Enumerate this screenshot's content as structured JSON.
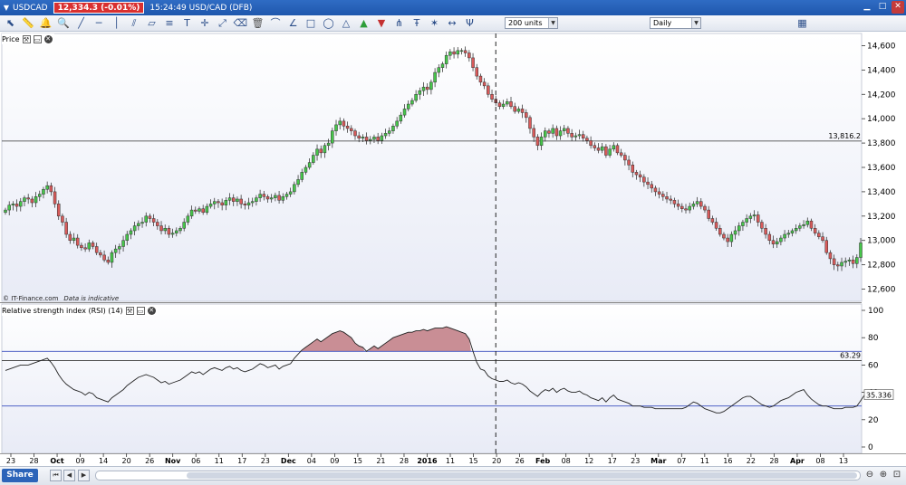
{
  "titlebar": {
    "symbol": "USDCAD",
    "price_badge": "12,334.3 (-0.01%)",
    "status": "15:24:49 USD/CAD (DFB)"
  },
  "toolbar": {
    "units_value": "200 units",
    "period_value": "Daily",
    "icons": [
      "cursor-icon",
      "ruler-icon",
      "bell-icon",
      "zoom-icon",
      "trend-line-icon",
      "horizontal-line-icon",
      "vertical-line-icon",
      "parallel-icon",
      "channel-icon",
      "fibonacci-icon",
      "text-icon",
      "crosshair-icon",
      "measure-icon",
      "eraser-icon",
      "trash-icon",
      "arc-icon",
      "angle-icon",
      "rectangle-icon",
      "ellipse-icon",
      "triangle-icon",
      "buy-arrow-icon",
      "sell-arrow-icon",
      "andrews-icon",
      "tk-icon",
      "gann-icon",
      "extend-icon",
      "pitchfork-icon",
      "chart-type-icon"
    ]
  },
  "price_panel": {
    "title": "Price",
    "credit": "© IT-Finance.com",
    "credit_note": "Data is indicative"
  },
  "rsi_panel": {
    "title": "Relative strength index (RSI) (14)",
    "current_label": "35.336"
  },
  "bottom": {
    "share_label": "Share"
  },
  "colors": {
    "up_candle": "#46c64a",
    "down_candle": "#d95a5a",
    "rsi_fill": "#c98e95",
    "band_line": "#3a4fbf",
    "plot_bg_top": "#ffffff",
    "plot_bg_bottom": "#e8ebf6"
  },
  "chart_data": [
    {
      "type": "candlestick",
      "title": "Price",
      "ylim": [
        12500,
        14700
      ],
      "y_ticks": [
        12600,
        12800,
        13000,
        13200,
        13400,
        13600,
        13800,
        14000,
        14200,
        14400,
        14600
      ],
      "y_tick_labels": [
        "12,600",
        "12,800",
        "13,000",
        "13,200",
        "13,400",
        "13,600",
        "13,800",
        "14,000",
        "14,200",
        "14,400",
        "14,600"
      ],
      "x_labels": [
        "23",
        "28",
        "Oct",
        "09",
        "14",
        "20",
        "26",
        "Nov",
        "06",
        "11",
        "17",
        "23",
        "Dec",
        "04",
        "09",
        "15",
        "21",
        "28",
        "2016",
        "11",
        "15",
        "20",
        "26",
        "Feb",
        "08",
        "12",
        "17",
        "23",
        "Mar",
        "07",
        "11",
        "16",
        "22",
        "28",
        "Apr",
        "08",
        "13"
      ],
      "bold_x_labels": [
        "Oct",
        "Nov",
        "Dec",
        "2016",
        "Feb",
        "Mar",
        "Apr"
      ],
      "horizontal_line": {
        "value": 13816.2,
        "label": "13,816.2"
      },
      "event_line_index": 129,
      "close": [
        13250,
        13290,
        13300,
        13280,
        13320,
        13350,
        13340,
        13310,
        13360,
        13380,
        13420,
        13450,
        13400,
        13300,
        13200,
        13150,
        13050,
        13000,
        13020,
        12960,
        12940,
        12930,
        12980,
        12950,
        12900,
        12880,
        12840,
        12820,
        12900,
        12930,
        12950,
        13000,
        13050,
        13080,
        13120,
        13140,
        13150,
        13200,
        13180,
        13150,
        13120,
        13080,
        13100,
        13050,
        13060,
        13080,
        13100,
        13150,
        13200,
        13250,
        13240,
        13260,
        13230,
        13280,
        13300,
        13320,
        13310,
        13290,
        13330,
        13350,
        13320,
        13340,
        13300,
        13290,
        13310,
        13320,
        13350,
        13380,
        13360,
        13340,
        13350,
        13370,
        13330,
        13360,
        13380,
        13400,
        13460,
        13500,
        13560,
        13600,
        13640,
        13700,
        13750,
        13720,
        13780,
        13800,
        13900,
        13950,
        13980,
        13940,
        13920,
        13900,
        13860,
        13840,
        13850,
        13820,
        13830,
        13850,
        13820,
        13860,
        13880,
        13900,
        13940,
        13980,
        14030,
        14080,
        14120,
        14150,
        14200,
        14230,
        14260,
        14240,
        14300,
        14380,
        14420,
        14450,
        14520,
        14550,
        14530,
        14560,
        14560,
        14540,
        14500,
        14420,
        14350,
        14300,
        14270,
        14200,
        14160,
        14130,
        14100,
        14120,
        14140,
        14100,
        14060,
        14080,
        14050,
        14010,
        13920,
        13850,
        13780,
        13850,
        13900,
        13880,
        13920,
        13860,
        13900,
        13920,
        13880,
        13850,
        13860,
        13870,
        13840,
        13820,
        13780,
        13760,
        13740,
        13770,
        13700,
        13750,
        13780,
        13720,
        13700,
        13660,
        13620,
        13560,
        13540,
        13520,
        13480,
        13460,
        13430,
        13400,
        13380,
        13360,
        13340,
        13330,
        13300,
        13280,
        13260,
        13250,
        13280,
        13300,
        13320,
        13280,
        13250,
        13180,
        13150,
        13100,
        13050,
        13020,
        12990,
        13050,
        13080,
        13120,
        13150,
        13180,
        13200,
        13210,
        13150,
        13100,
        13050,
        13000,
        12970,
        12990,
        13020,
        13050,
        13060,
        13080,
        13100,
        13120,
        13130,
        13160,
        13100,
        13060,
        13030,
        13000,
        12900,
        12850,
        12800,
        12790,
        12820,
        12830,
        12840,
        12810,
        12860,
        12980
      ],
      "rsi": {
        "ylim": [
          0,
          100
        ],
        "y_ticks": [
          0,
          20,
          40,
          60,
          80,
          100
        ],
        "levels": [
          30,
          70
        ],
        "last_label_value": 63.29,
        "values": [
          56,
          57,
          58,
          59,
          60,
          60,
          60,
          61,
          62,
          63,
          64,
          65,
          62,
          58,
          53,
          49,
          46,
          44,
          42,
          41,
          40,
          38,
          40,
          39,
          36,
          35,
          34,
          33,
          36,
          38,
          40,
          42,
          45,
          47,
          49,
          51,
          52,
          53,
          52,
          51,
          49,
          47,
          48,
          46,
          47,
          48,
          49,
          51,
          53,
          55,
          54,
          55,
          53,
          55,
          57,
          58,
          57,
          56,
          58,
          59,
          57,
          58,
          56,
          55,
          56,
          57,
          59,
          61,
          60,
          58,
          59,
          60,
          57,
          59,
          60,
          61,
          65,
          68,
          71,
          73,
          75,
          77,
          79,
          77,
          79,
          81,
          83,
          84,
          85,
          84,
          82,
          80,
          76,
          74,
          73,
          70,
          72,
          74,
          72,
          74,
          76,
          78,
          80,
          81,
          82,
          83,
          84,
          84,
          85,
          85,
          86,
          85,
          86,
          87,
          87,
          87,
          88,
          87,
          86,
          85,
          84,
          83,
          79,
          70,
          62,
          57,
          56,
          52,
          50,
          49,
          48,
          48,
          49,
          47,
          46,
          47,
          46,
          44,
          41,
          39,
          37,
          40,
          42,
          41,
          43,
          40,
          42,
          43,
          41,
          40,
          40,
          41,
          39,
          38,
          36,
          35,
          34,
          36,
          33,
          36,
          38,
          35,
          34,
          33,
          32,
          30,
          30,
          30,
          29,
          29,
          29,
          28,
          28,
          28,
          28,
          28,
          28,
          28,
          28,
          29,
          31,
          33,
          32,
          30,
          28,
          27,
          26,
          25,
          25,
          26,
          28,
          30,
          32,
          34,
          36,
          37,
          37,
          35,
          33,
          31,
          30,
          29,
          30,
          32,
          34,
          35,
          36,
          38,
          40,
          41,
          42,
          38,
          35,
          33,
          31,
          30,
          30,
          29,
          28,
          28,
          28,
          29,
          29,
          29,
          30,
          34,
          38
        ]
      }
    }
  ]
}
